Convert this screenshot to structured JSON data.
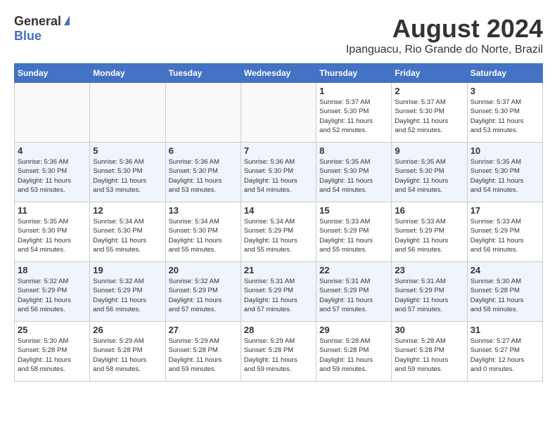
{
  "header": {
    "logo_general": "General",
    "logo_blue": "Blue",
    "month_year": "August 2024",
    "location": "Ipanguacu, Rio Grande do Norte, Brazil"
  },
  "days_of_week": [
    "Sunday",
    "Monday",
    "Tuesday",
    "Wednesday",
    "Thursday",
    "Friday",
    "Saturday"
  ],
  "weeks": [
    {
      "days": [
        {
          "num": "",
          "info": ""
        },
        {
          "num": "",
          "info": ""
        },
        {
          "num": "",
          "info": ""
        },
        {
          "num": "",
          "info": ""
        },
        {
          "num": "1",
          "info": "Sunrise: 5:37 AM\nSunset: 5:30 PM\nDaylight: 11 hours\nand 52 minutes."
        },
        {
          "num": "2",
          "info": "Sunrise: 5:37 AM\nSunset: 5:30 PM\nDaylight: 11 hours\nand 52 minutes."
        },
        {
          "num": "3",
          "info": "Sunrise: 5:37 AM\nSunset: 5:30 PM\nDaylight: 11 hours\nand 53 minutes."
        }
      ]
    },
    {
      "days": [
        {
          "num": "4",
          "info": "Sunrise: 5:36 AM\nSunset: 5:30 PM\nDaylight: 11 hours\nand 53 minutes."
        },
        {
          "num": "5",
          "info": "Sunrise: 5:36 AM\nSunset: 5:30 PM\nDaylight: 11 hours\nand 53 minutes."
        },
        {
          "num": "6",
          "info": "Sunrise: 5:36 AM\nSunset: 5:30 PM\nDaylight: 11 hours\nand 53 minutes."
        },
        {
          "num": "7",
          "info": "Sunrise: 5:36 AM\nSunset: 5:30 PM\nDaylight: 11 hours\nand 54 minutes."
        },
        {
          "num": "8",
          "info": "Sunrise: 5:35 AM\nSunset: 5:30 PM\nDaylight: 11 hours\nand 54 minutes."
        },
        {
          "num": "9",
          "info": "Sunrise: 5:35 AM\nSunset: 5:30 PM\nDaylight: 11 hours\nand 54 minutes."
        },
        {
          "num": "10",
          "info": "Sunrise: 5:35 AM\nSunset: 5:30 PM\nDaylight: 11 hours\nand 54 minutes."
        }
      ]
    },
    {
      "days": [
        {
          "num": "11",
          "info": "Sunrise: 5:35 AM\nSunset: 5:30 PM\nDaylight: 11 hours\nand 54 minutes."
        },
        {
          "num": "12",
          "info": "Sunrise: 5:34 AM\nSunset: 5:30 PM\nDaylight: 11 hours\nand 55 minutes."
        },
        {
          "num": "13",
          "info": "Sunrise: 5:34 AM\nSunset: 5:30 PM\nDaylight: 11 hours\nand 55 minutes."
        },
        {
          "num": "14",
          "info": "Sunrise: 5:34 AM\nSunset: 5:29 PM\nDaylight: 11 hours\nand 55 minutes."
        },
        {
          "num": "15",
          "info": "Sunrise: 5:33 AM\nSunset: 5:29 PM\nDaylight: 11 hours\nand 55 minutes."
        },
        {
          "num": "16",
          "info": "Sunrise: 5:33 AM\nSunset: 5:29 PM\nDaylight: 11 hours\nand 56 minutes."
        },
        {
          "num": "17",
          "info": "Sunrise: 5:33 AM\nSunset: 5:29 PM\nDaylight: 11 hours\nand 56 minutes."
        }
      ]
    },
    {
      "days": [
        {
          "num": "18",
          "info": "Sunrise: 5:32 AM\nSunset: 5:29 PM\nDaylight: 11 hours\nand 56 minutes."
        },
        {
          "num": "19",
          "info": "Sunrise: 5:32 AM\nSunset: 5:29 PM\nDaylight: 11 hours\nand 56 minutes."
        },
        {
          "num": "20",
          "info": "Sunrise: 5:32 AM\nSunset: 5:29 PM\nDaylight: 11 hours\nand 57 minutes."
        },
        {
          "num": "21",
          "info": "Sunrise: 5:31 AM\nSunset: 5:29 PM\nDaylight: 11 hours\nand 57 minutes."
        },
        {
          "num": "22",
          "info": "Sunrise: 5:31 AM\nSunset: 5:29 PM\nDaylight: 11 hours\nand 57 minutes."
        },
        {
          "num": "23",
          "info": "Sunrise: 5:31 AM\nSunset: 5:29 PM\nDaylight: 11 hours\nand 57 minutes."
        },
        {
          "num": "24",
          "info": "Sunrise: 5:30 AM\nSunset: 5:28 PM\nDaylight: 11 hours\nand 58 minutes."
        }
      ]
    },
    {
      "days": [
        {
          "num": "25",
          "info": "Sunrise: 5:30 AM\nSunset: 5:28 PM\nDaylight: 11 hours\nand 58 minutes."
        },
        {
          "num": "26",
          "info": "Sunrise: 5:29 AM\nSunset: 5:28 PM\nDaylight: 11 hours\nand 58 minutes."
        },
        {
          "num": "27",
          "info": "Sunrise: 5:29 AM\nSunset: 5:28 PM\nDaylight: 11 hours\nand 59 minutes."
        },
        {
          "num": "28",
          "info": "Sunrise: 5:29 AM\nSunset: 5:28 PM\nDaylight: 11 hours\nand 59 minutes."
        },
        {
          "num": "29",
          "info": "Sunrise: 5:28 AM\nSunset: 5:28 PM\nDaylight: 11 hours\nand 59 minutes."
        },
        {
          "num": "30",
          "info": "Sunrise: 5:28 AM\nSunset: 5:28 PM\nDaylight: 11 hours\nand 59 minutes."
        },
        {
          "num": "31",
          "info": "Sunrise: 5:27 AM\nSunset: 5:27 PM\nDaylight: 12 hours\nand 0 minutes."
        }
      ]
    }
  ]
}
